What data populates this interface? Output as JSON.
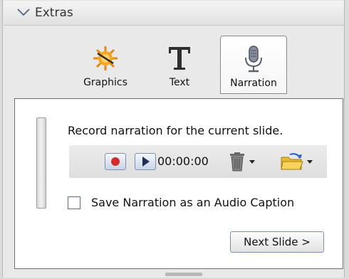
{
  "header": {
    "title": "Extras"
  },
  "tabs": [
    {
      "label": "Graphics",
      "icon": "graphics-sun-icon",
      "selected": false
    },
    {
      "label": "Text",
      "icon": "text-t-icon",
      "selected": false
    },
    {
      "label": "Narration",
      "icon": "microphone-icon",
      "selected": true
    }
  ],
  "narration": {
    "instruction": "Record narration for the current slide.",
    "time": "00:00:00",
    "checkbox_label": "Save Narration as an Audio Caption",
    "checkbox_checked": false,
    "next_label": "Next Slide >"
  },
  "colors": {
    "record": "#d62a2a",
    "play": "#1f2f52",
    "button_border": "#7f93b1"
  }
}
